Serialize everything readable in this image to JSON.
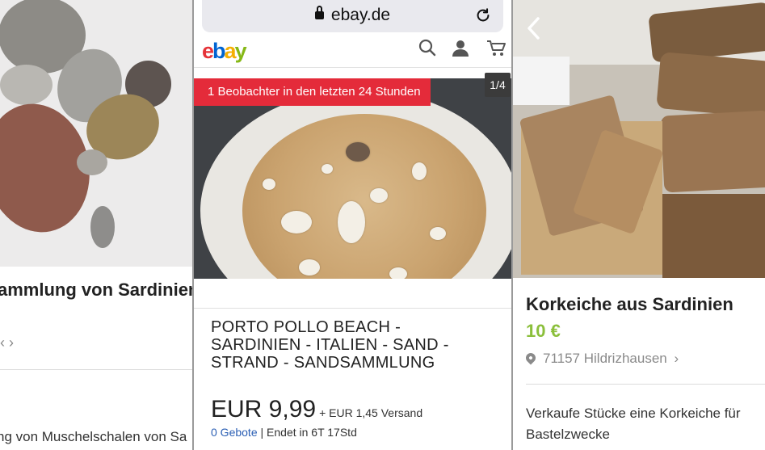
{
  "panel_left": {
    "title": "ammlung von Sardinien",
    "chevron": "‹ ›",
    "description": "ng von Muschelschalen von Sa"
  },
  "panel_ebay": {
    "url": "ebay.de",
    "logo_letters": [
      "e",
      "b",
      "a",
      "y"
    ],
    "logo_colors": [
      "#e53238",
      "#0064d2",
      "#f5af02",
      "#86b817"
    ],
    "header_icons": [
      "search-icon",
      "user-icon",
      "cart-icon"
    ],
    "watcher_badge": "1 Beobachter in den letzten 24 Stunden",
    "image_counter": "1/4",
    "title": "PORTO POLLO BEACH - SARDINIEN - ITALIEN - SAND - STRAND - SANDSAMMLUNG",
    "price": "EUR 9,99",
    "shipping": "+ EUR 1,45 Versand",
    "bids": "0 Gebote",
    "separator": "|",
    "ends": "Endet in 6T 17Std"
  },
  "panel_right": {
    "title": "Korkeiche aus Sardinien",
    "price": "10 €",
    "price_color": "#8bbf3b",
    "location": "71157 Hildrizhausen",
    "location_chevron": "›",
    "description": "Verkaufe Stücke eine Korkeiche für Bastelzwecke"
  }
}
